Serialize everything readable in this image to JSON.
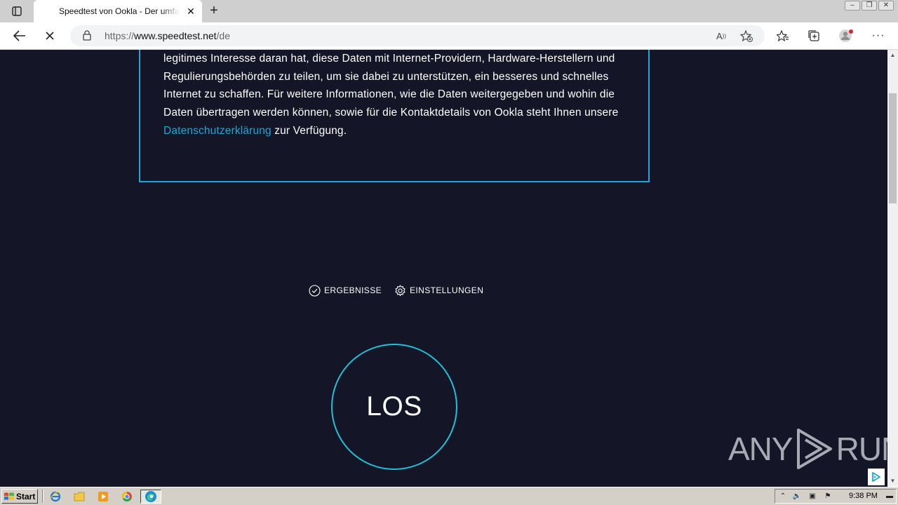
{
  "browser": {
    "tab_title": "Speedtest von Ookla - Der umfassende Geschwindigkeitstest",
    "url_prefix": "https://",
    "url_host": "www.speedtest.net",
    "url_path": "/de"
  },
  "consent": {
    "text_before_link": "legitimes Interesse daran hat, diese Daten mit Internet-Providern, Hardware-Herstellern und Regulierungsbehörden zu teilen, um sie dabei zu unterstützen, ein besseres und schnelles Internet zu schaffen. Für weitere Informationen, wie die Daten weitergegeben und wohin die Daten übertragen werden können, sowie für die Kontaktdetails von Ookla steht Ihnen unsere ",
    "link_text": "Datenschutzerklärung",
    "text_after_link": " zur Verfügung."
  },
  "controls": {
    "results_label": "ERGEBNISSE",
    "settings_label": "EINSTELLUNGEN"
  },
  "go_button": {
    "label": "LOS"
  },
  "watermark": {
    "left": "ANY",
    "right": "RUN"
  },
  "taskbar": {
    "start_label": "Start",
    "clock": "9:38 PM"
  },
  "colors": {
    "page_background": "#141526",
    "accent": "#1ba7da",
    "go_ring": "#1fc2d8"
  }
}
